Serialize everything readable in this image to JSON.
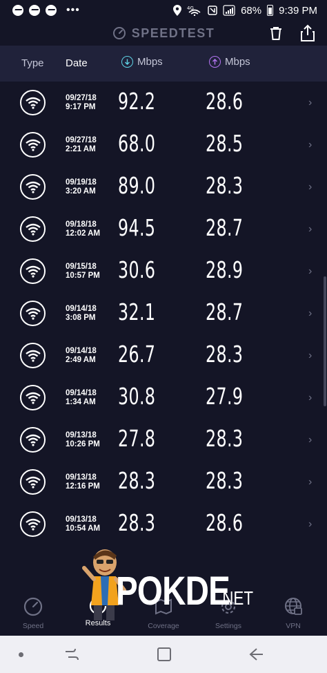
{
  "status_bar": {
    "time": "9:39 PM",
    "battery": "68%",
    "network": "4G",
    "icons": [
      "messenger-icon",
      "messenger-icon",
      "messenger-icon",
      "more-dots",
      "location-icon",
      "wifi-icon",
      "nfc-icon",
      "signal-icon",
      "battery-icon"
    ]
  },
  "header": {
    "title": "SPEEDTEST",
    "columns": {
      "type": "Type",
      "date": "Date",
      "download": "Mbps",
      "upload": "Mbps"
    }
  },
  "colors": {
    "background": "#141526",
    "header_bg": "#20223a",
    "download_accent": "#5fd4e6",
    "upload_accent": "#b475f2",
    "muted": "#6f7186"
  },
  "results": [
    {
      "date": "09/27/18",
      "time": "9:17 PM",
      "download": "92.2",
      "upload": "28.6"
    },
    {
      "date": "09/27/18",
      "time": "2:21 AM",
      "download": "68.0",
      "upload": "28.5"
    },
    {
      "date": "09/19/18",
      "time": "3:20 AM",
      "download": "89.0",
      "upload": "28.3"
    },
    {
      "date": "09/18/18",
      "time": "12:02 AM",
      "download": "94.5",
      "upload": "28.7"
    },
    {
      "date": "09/15/18",
      "time": "10:57 PM",
      "download": "30.6",
      "upload": "28.9"
    },
    {
      "date": "09/14/18",
      "time": "3:08 PM",
      "download": "32.1",
      "upload": "28.7"
    },
    {
      "date": "09/14/18",
      "time": "2:49 AM",
      "download": "26.7",
      "upload": "28.3"
    },
    {
      "date": "09/14/18",
      "time": "1:34 AM",
      "download": "30.8",
      "upload": "27.9"
    },
    {
      "date": "09/13/18",
      "time": "10:26 PM",
      "download": "27.8",
      "upload": "28.3"
    },
    {
      "date": "09/13/18",
      "time": "12:16 PM",
      "download": "28.3",
      "upload": "28.3"
    },
    {
      "date": "09/13/18",
      "time": "10:54 AM",
      "download": "28.3",
      "upload": "28.6"
    }
  ],
  "bottom_nav": {
    "speed": "Speed",
    "results": "Results",
    "coverage": "Coverage",
    "settings": "Settings",
    "vpn": "VPN",
    "active": "results"
  },
  "watermark": {
    "text": "POKDE",
    "suffix": ".NET"
  }
}
